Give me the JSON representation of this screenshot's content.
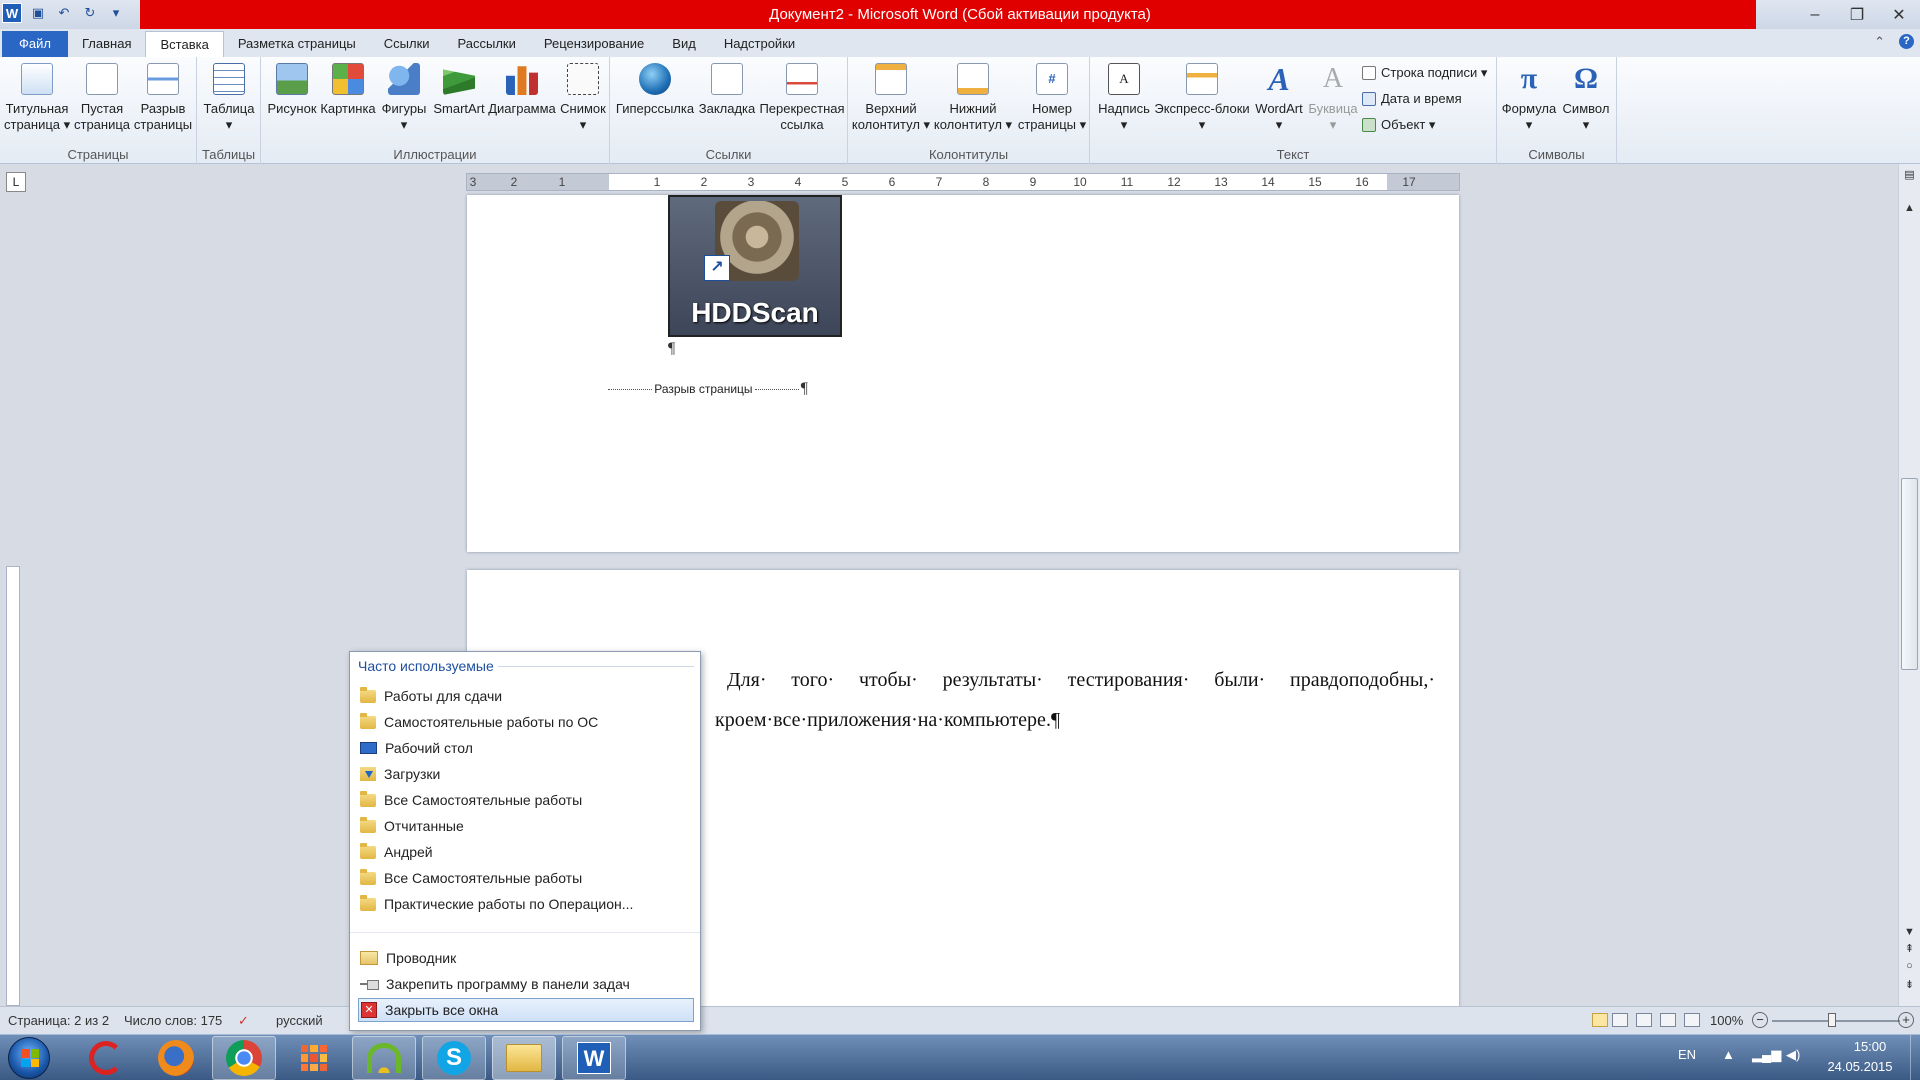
{
  "window": {
    "title": "Документ2 - Microsoft Word (Сбой активации продукта)",
    "qat_logo": "W",
    "controls": [
      "–",
      "❐",
      "✕"
    ]
  },
  "tabs": [
    {
      "label": "Файл"
    },
    {
      "label": "Главная"
    },
    {
      "label": "Вставка"
    },
    {
      "label": "Разметка страницы"
    },
    {
      "label": "Ссылки"
    },
    {
      "label": "Рассылки"
    },
    {
      "label": "Рецензирование"
    },
    {
      "label": "Вид"
    },
    {
      "label": "Надстройки"
    }
  ],
  "ribbon": {
    "groups": {
      "pages": "Страницы",
      "tables": "Таблицы",
      "illustrations": "Иллюстрации",
      "links": "Ссылки",
      "headers": "Колонтитулы",
      "text": "Текст",
      "symbols": "Символы"
    },
    "buttons": {
      "cover_page": "Титульная\nстраница ▾",
      "blank_page": "Пустая\nстраница",
      "page_break": "Разрыв\nстраницы",
      "table": "Таблица\n▾",
      "picture": "Рисунок",
      "clipart": "Картинка",
      "shapes": "Фигуры\n▾",
      "smartart": "SmartArt",
      "chart": "Диаграмма",
      "screenshot": "Снимок\n▾",
      "hyperlink": "Гиперссылка",
      "bookmark": "Закладка",
      "crossref": "Перекрестная\nссылка",
      "header": "Верхний\nколонтитул ▾",
      "footer": "Нижний\nколонтитул ▾",
      "page_number": "Номер\nстраницы ▾",
      "textbox": "Надпись\n▾",
      "quickparts": "Экспресс-блоки\n▾",
      "wordart": "WordArt\n▾",
      "dropcap": "Буквица\n▾",
      "signature_line": "Строка подписи ▾",
      "datetime": "Дата и время",
      "object": "Объект ▾",
      "equation": "Формула\n▾",
      "symbol": "Символ\n▾"
    }
  },
  "ruler": {
    "tab_selector": "L",
    "numbers": [
      "3",
      "2",
      "1",
      "1",
      "2",
      "3",
      "4",
      "5",
      "6",
      "7",
      "8",
      "9",
      "10",
      "11",
      "12",
      "13",
      "14",
      "15",
      "16",
      "17"
    ]
  },
  "document": {
    "image_label": "HDDScan",
    "pilcrow": "¶",
    "page_break_text": "Разрыв страницы",
    "paragraph_line1": "Для· того· чтобы· результаты· тестирования· были· правдоподобны,·",
    "paragraph_line2": "кроем·все·приложения·на·компьютере.¶"
  },
  "jumplist": {
    "header": "Часто используемые",
    "items": [
      {
        "label": "Работы для сдачи",
        "icon": "folder-icon"
      },
      {
        "label": "Самостоятельные работы по ОС",
        "icon": "folder-icon"
      },
      {
        "label": "Рабочий стол",
        "icon": "desktop-icon"
      },
      {
        "label": "Загрузки",
        "icon": "downloads-icon"
      },
      {
        "label": "Все Самостоятельные работы",
        "icon": "folder-icon"
      },
      {
        "label": "Отчитанные",
        "icon": "folder-icon"
      },
      {
        "label": "Андрей",
        "icon": "folder-icon"
      },
      {
        "label": "Все Самостоятельные работы",
        "icon": "folder-icon"
      },
      {
        "label": "Практические работы по Операцион...",
        "icon": "folder-icon"
      }
    ],
    "tasks": [
      {
        "label": "Проводник",
        "icon": "explorer-icon"
      },
      {
        "label": "Закрепить программу в панели задач",
        "icon": "pin-icon"
      },
      {
        "label": "Закрыть все окна",
        "icon": "close-windows-icon"
      }
    ]
  },
  "statusbar": {
    "page": "Страница: 2 из 2",
    "words": "Число слов: 175",
    "language": "русский",
    "zoom": "100%",
    "zoom_minus": "−",
    "zoom_plus": "+"
  },
  "taskbar": {
    "lang": "EN",
    "time": "15:00",
    "date": "24.05.2015",
    "apps": [
      "ccleaner-icon",
      "firefox-icon",
      "chrome-icon",
      "metro-apps-icon",
      "wifi-app-icon",
      "skype-icon",
      "explorer-icon",
      "word-icon"
    ]
  },
  "colors": {
    "title_bar": "#e00000",
    "file_tab": "#2a67c4",
    "taskbar": "#3a5a85"
  }
}
